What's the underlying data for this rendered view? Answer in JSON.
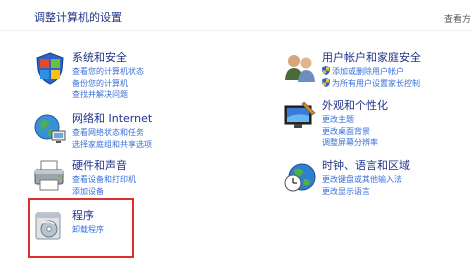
{
  "header": {
    "title": "调整计算机的设置",
    "view_by": "查看方"
  },
  "categories": [
    {
      "title": "系统和安全",
      "icon": "shield-flag-icon",
      "links": [
        "查看您的计算机状态",
        "备份您的计算机",
        "查找并解决问题"
      ]
    },
    {
      "title": "网络和 Internet",
      "icon": "globe-network-icon",
      "links": [
        "查看网络状态和任务",
        "选择家庭组和共享选项"
      ]
    },
    {
      "title": "硬件和声音",
      "icon": "printer-icon",
      "links": [
        "查看设备和打印机",
        "添加设备"
      ]
    },
    {
      "title": "程序",
      "icon": "programs-disc-icon",
      "links": [
        "卸载程序"
      ]
    },
    {
      "title": "用户帐户和家庭安全",
      "icon": "users-icon",
      "links": [
        "添加或删除用户帐户",
        "为所有用户设置家长控制"
      ]
    },
    {
      "title": "外观和个性化",
      "icon": "monitor-brush-icon",
      "links": [
        "更改主题",
        "更改桌面背景",
        "调整屏幕分辨率"
      ]
    },
    {
      "title": "时钟、语言和区域",
      "icon": "clock-globe-icon",
      "links": [
        "更改键盘或其他输入法",
        "更改显示语言"
      ]
    }
  ],
  "colors": {
    "title": "#1e3287",
    "link": "#3a6fd8",
    "highlight": "#e03030"
  }
}
